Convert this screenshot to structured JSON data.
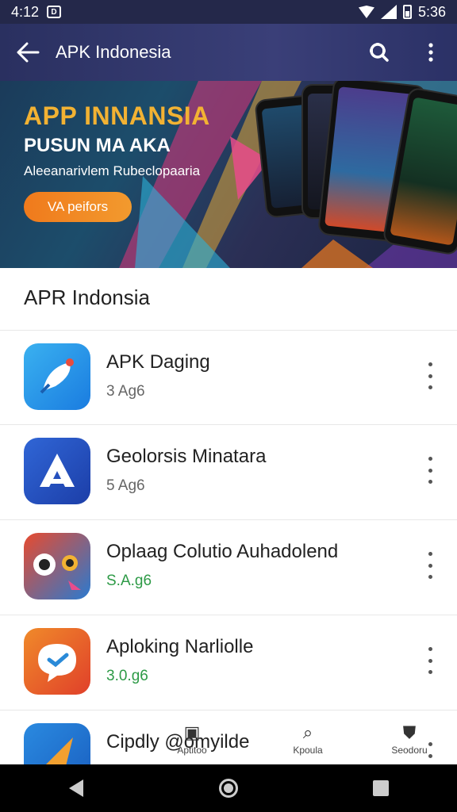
{
  "status": {
    "time": "4:12",
    "battery_time": "5:36",
    "notif_icon": "notification-icon"
  },
  "appbar": {
    "title": "APK Indonesia",
    "back_icon": "arrow-left-icon",
    "search_icon": "search-icon",
    "more_icon": "more-vertical-icon"
  },
  "banner": {
    "headline": "APP INNANSIA",
    "subhead": "PUSUN MA AKA",
    "tagline": "Aleeanarivlem Rubeclopaaria",
    "cta": "VA peifors"
  },
  "section": {
    "title": "APR Indonsia"
  },
  "apps": [
    {
      "name": "APK Daging",
      "size": "3 Ag6",
      "size_color": "gray"
    },
    {
      "name": "Geolorsis Minatara",
      "size": "5 Ag6",
      "size_color": "gray"
    },
    {
      "name": "Oplaag Colutio Auhadolend",
      "size": "S.A.g6",
      "size_color": "green"
    },
    {
      "name": "Aploking Narliolle",
      "size": "3.0.g6",
      "size_color": "green"
    },
    {
      "name": "Cipdly @omyilde",
      "size": "",
      "size_color": "gray"
    }
  ],
  "bottom_tabs": [
    {
      "label": "Aptitoo",
      "icon": "apps-icon"
    },
    {
      "label": "Kpoula",
      "icon": "search-icon"
    },
    {
      "label": "Seodoru",
      "icon": "shield-icon"
    }
  ],
  "navbar": {
    "back": "back-icon",
    "home": "home-icon",
    "recents": "recents-icon"
  },
  "colors": {
    "appbar": "#2a3060",
    "accent_orange": "#f07a1c",
    "headline_gold": "#f2b233",
    "size_green": "#2d9a46"
  }
}
